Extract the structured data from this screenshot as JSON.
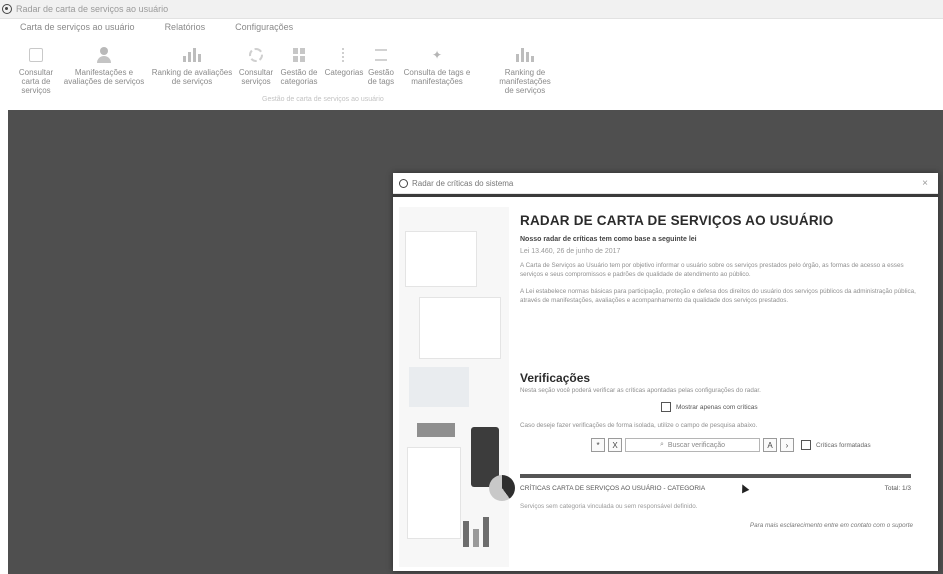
{
  "window": {
    "title": "Radar de carta de serviços ao usuário"
  },
  "tabs": [
    "Carta de serviços ao usuário",
    "Relatórios",
    "Configurações"
  ],
  "ribbon": {
    "buttons": [
      {
        "label_1": "Consultar",
        "label_2": "carta de serviços"
      },
      {
        "label_1": "Manifestações e",
        "label_2": "avaliações de serviços"
      },
      {
        "label_1": "Ranking de avaliações",
        "label_2": "de serviços"
      },
      {
        "label_1": "Consultar",
        "label_2": "serviços"
      },
      {
        "label_1": "Gestão de",
        "label_2": "categorias"
      },
      {
        "label_1": "Categorias",
        "label_2": ""
      },
      {
        "label_1": "Gestão",
        "label_2": "de tags"
      },
      {
        "label_1": "Consulta de tags e",
        "label_2": "manifestações"
      },
      {
        "label_1": "Ranking de manifestações",
        "label_2": "de serviços"
      }
    ],
    "group_label": "Gestão de carta de serviços ao usuário"
  },
  "dialog": {
    "title": "Radar de críticas do sistema",
    "close": "×",
    "heading": "RADAR DE CARTA DE SERVIÇOS AO USUÁRIO",
    "subtitle": "Nosso radar de críticas tem como base a seguinte lei",
    "date_line": "Lei 13.460, 26 de junho de 2017",
    "para1": "A Carta de Serviços ao Usuário tem por objetivo informar o usuário sobre os serviços prestados pelo órgão, as formas de acesso a esses serviços e seus compromissos e padrões de qualidade de atendimento ao público.",
    "para2": "A Lei estabelece normas básicas para participação, proteção e defesa dos direitos do usuário dos serviços públicos da administração pública, através de manifestações, avaliações e acompanhamento da qualidade dos serviços prestados.",
    "verif_heading": "Verificações",
    "verif_desc": "Nesta seção você poderá verificar as críticas apontadas pelas configurações do radar.",
    "show_only_label": "Mostrar apenas com críticas",
    "verif_desc2": "Caso deseje fazer verificações de forma isolada, utilize o campo de pesquisa abaixo.",
    "btn_star": "*",
    "btn_x": "X",
    "search_placeholder": "Buscar verificação",
    "btn_nav": "A",
    "btn_next": "›",
    "option_label": "Críticas formatadas",
    "result_title": "CRÍTICAS CARTA DE SERVIÇOS AO USUÁRIO - CATEGORIA",
    "result_count": "Total: 1/3",
    "result_desc": "Serviços sem categoria vinculada ou sem responsável definido.",
    "footer": "Para mais esclarecimento entre em contato com o suporte"
  }
}
